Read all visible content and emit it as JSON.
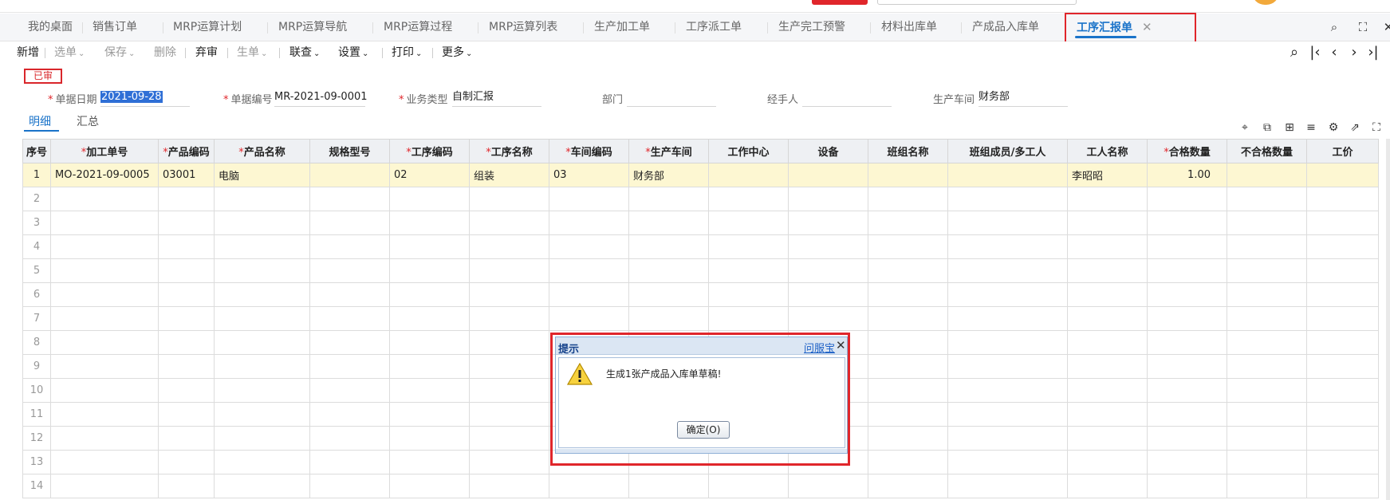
{
  "tabs": [
    {
      "label": "我的桌面"
    },
    {
      "label": "销售订单"
    },
    {
      "label": "MRP运算计划"
    },
    {
      "label": "MRP运算导航"
    },
    {
      "label": "MRP运算过程"
    },
    {
      "label": "MRP运算列表"
    },
    {
      "label": "生产加工单"
    },
    {
      "label": "工序派工单"
    },
    {
      "label": "生产完工预警"
    },
    {
      "label": "材料出库单"
    },
    {
      "label": "产成品入库单"
    },
    {
      "label": "工序汇报单",
      "active": true
    }
  ],
  "toolbar": {
    "new": "新增",
    "select_doc": "选单",
    "save": "保存",
    "delete": "删除",
    "abandon_review": "弃审",
    "generate_doc": "生单",
    "linked_query": "联查",
    "settings": "设置",
    "print": "打印",
    "more": "更多"
  },
  "status_stamp": "已审",
  "form": {
    "date_label": "单据日期",
    "date_value": "2021-09-28",
    "code_label": "单据编号",
    "code_value": "MR-2021-09-0001",
    "biz_type_label": "业务类型",
    "biz_type_value": "自制汇报",
    "dept_label": "部门",
    "dept_value": "",
    "handler_label": "经手人",
    "handler_value": "",
    "workshop_label": "生产车间",
    "workshop_value": "财务部"
  },
  "detail_tabs": {
    "detail": "明细",
    "summary": "汇总"
  },
  "grid": {
    "columns": [
      {
        "label": "序号",
        "required": false
      },
      {
        "label": "加工单号",
        "required": true
      },
      {
        "label": "产品编码",
        "required": true
      },
      {
        "label": "产品名称",
        "required": true
      },
      {
        "label": "规格型号",
        "required": false
      },
      {
        "label": "工序编码",
        "required": true
      },
      {
        "label": "工序名称",
        "required": true
      },
      {
        "label": "车间编码",
        "required": true
      },
      {
        "label": "生产车间",
        "required": true
      },
      {
        "label": "工作中心",
        "required": false
      },
      {
        "label": "设备",
        "required": false
      },
      {
        "label": "班组名称",
        "required": false
      },
      {
        "label": "班组成员/多工人",
        "required": false
      },
      {
        "label": "工人名称",
        "required": false
      },
      {
        "label": "合格数量",
        "required": true
      },
      {
        "label": "不合格数量",
        "required": false
      },
      {
        "label": "工价",
        "required": false
      }
    ],
    "rows": [
      [
        "1",
        "MO-2021-09-0005",
        "03001",
        "电脑",
        "",
        "02",
        "组装",
        "03",
        "财务部",
        "",
        "",
        "",
        "",
        "李昭昭",
        "1.00",
        "",
        ""
      ],
      [
        "2"
      ],
      [
        "3"
      ],
      [
        "4"
      ],
      [
        "5"
      ],
      [
        "6"
      ],
      [
        "7"
      ],
      [
        "8"
      ],
      [
        "9"
      ],
      [
        "10"
      ],
      [
        "11"
      ],
      [
        "12"
      ],
      [
        "13"
      ],
      [
        "14"
      ]
    ]
  },
  "dialog": {
    "title": "提示",
    "help_link": "问服宝",
    "message": "生成1张产成品入库单草稿!",
    "ok_button": "确定(O)"
  },
  "colors": {
    "accent": "#1a73c9",
    "highlight_red": "#e0262b",
    "selected_row": "#fdf7d2"
  }
}
